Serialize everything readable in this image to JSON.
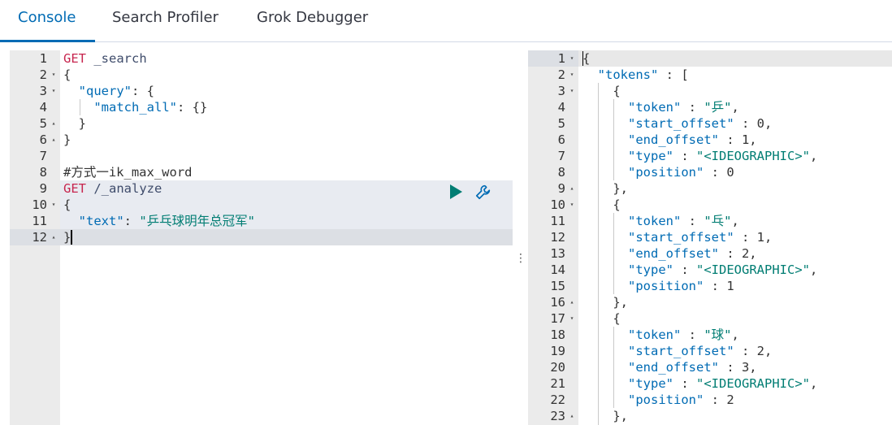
{
  "tabs": [
    {
      "label": "Console"
    },
    {
      "label": "Search Profiler"
    },
    {
      "label": "Grok Debugger"
    }
  ],
  "request": {
    "line_numbers": [
      "1",
      "2",
      "3",
      "4",
      "5",
      "6",
      "7",
      "8",
      "9",
      "10",
      "11",
      "12"
    ],
    "lines": [
      {
        "parts": [
          {
            "t": "GET",
            "c": "k-method"
          },
          {
            "t": " _search",
            "c": "k-path"
          }
        ]
      },
      {
        "parts": [
          {
            "t": "{",
            "c": ""
          }
        ]
      },
      {
        "parts": [
          {
            "t": "  ",
            "c": ""
          },
          {
            "t": "\"query\"",
            "c": "k-key"
          },
          {
            "t": ": {",
            "c": ""
          }
        ]
      },
      {
        "parts": [
          {
            "t": "    ",
            "c": ""
          },
          {
            "t": "\"match_all\"",
            "c": "k-key"
          },
          {
            "t": ": {}",
            "c": ""
          }
        ]
      },
      {
        "parts": [
          {
            "t": "  }",
            "c": ""
          }
        ]
      },
      {
        "parts": [
          {
            "t": "}",
            "c": ""
          }
        ]
      },
      {
        "parts": [
          {
            "t": "",
            "c": ""
          }
        ]
      },
      {
        "parts": [
          {
            "t": "#方式一ik_max_word",
            "c": "k-comment"
          }
        ]
      },
      {
        "parts": [
          {
            "t": "GET",
            "c": "k-method"
          },
          {
            "t": " /_analyze",
            "c": "k-path"
          }
        ]
      },
      {
        "parts": [
          {
            "t": "{",
            "c": ""
          }
        ]
      },
      {
        "parts": [
          {
            "t": "  ",
            "c": ""
          },
          {
            "t": "\"text\"",
            "c": "k-key"
          },
          {
            "t": ": ",
            "c": ""
          },
          {
            "t": "\"乒乓球明年总冠军\"",
            "c": "k-str"
          }
        ]
      },
      {
        "parts": [
          {
            "t": "}",
            "c": ""
          }
        ]
      }
    ],
    "folds": [
      "",
      "▾",
      "▾",
      "",
      "▴",
      "▴",
      "",
      "",
      "",
      "▾",
      "",
      "▴"
    ]
  },
  "response": {
    "line_numbers": [
      "1",
      "2",
      "3",
      "4",
      "5",
      "6",
      "7",
      "8",
      "9",
      "10",
      "11",
      "12",
      "13",
      "14",
      "15",
      "16",
      "17",
      "18",
      "19",
      "20",
      "21",
      "22",
      "23"
    ],
    "folds": [
      "▾",
      "▾",
      "▾",
      "",
      "",
      "",
      "",
      "",
      "▴",
      "▾",
      "",
      "",
      "",
      "",
      "",
      "▴",
      "▾",
      "",
      "",
      "",
      "",
      "",
      "▴"
    ],
    "lines": [
      {
        "parts": [
          {
            "t": "{",
            "c": ""
          }
        ]
      },
      {
        "parts": [
          {
            "t": "  ",
            "c": ""
          },
          {
            "t": "\"tokens\"",
            "c": "k-key"
          },
          {
            "t": " : [",
            "c": ""
          }
        ]
      },
      {
        "parts": [
          {
            "t": "    {",
            "c": ""
          }
        ]
      },
      {
        "parts": [
          {
            "t": "      ",
            "c": ""
          },
          {
            "t": "\"token\"",
            "c": "k-key"
          },
          {
            "t": " : ",
            "c": ""
          },
          {
            "t": "\"乒\"",
            "c": "k-str"
          },
          {
            "t": ",",
            "c": ""
          }
        ]
      },
      {
        "parts": [
          {
            "t": "      ",
            "c": ""
          },
          {
            "t": "\"start_offset\"",
            "c": "k-key"
          },
          {
            "t": " : 0,",
            "c": ""
          }
        ]
      },
      {
        "parts": [
          {
            "t": "      ",
            "c": ""
          },
          {
            "t": "\"end_offset\"",
            "c": "k-key"
          },
          {
            "t": " : 1,",
            "c": ""
          }
        ]
      },
      {
        "parts": [
          {
            "t": "      ",
            "c": ""
          },
          {
            "t": "\"type\"",
            "c": "k-key"
          },
          {
            "t": " : ",
            "c": ""
          },
          {
            "t": "\"<IDEOGRAPHIC>\"",
            "c": "k-str"
          },
          {
            "t": ",",
            "c": ""
          }
        ]
      },
      {
        "parts": [
          {
            "t": "      ",
            "c": ""
          },
          {
            "t": "\"position\"",
            "c": "k-key"
          },
          {
            "t": " : 0",
            "c": ""
          }
        ]
      },
      {
        "parts": [
          {
            "t": "    },",
            "c": ""
          }
        ]
      },
      {
        "parts": [
          {
            "t": "    {",
            "c": ""
          }
        ]
      },
      {
        "parts": [
          {
            "t": "      ",
            "c": ""
          },
          {
            "t": "\"token\"",
            "c": "k-key"
          },
          {
            "t": " : ",
            "c": ""
          },
          {
            "t": "\"乓\"",
            "c": "k-str"
          },
          {
            "t": ",",
            "c": ""
          }
        ]
      },
      {
        "parts": [
          {
            "t": "      ",
            "c": ""
          },
          {
            "t": "\"start_offset\"",
            "c": "k-key"
          },
          {
            "t": " : 1,",
            "c": ""
          }
        ]
      },
      {
        "parts": [
          {
            "t": "      ",
            "c": ""
          },
          {
            "t": "\"end_offset\"",
            "c": "k-key"
          },
          {
            "t": " : 2,",
            "c": ""
          }
        ]
      },
      {
        "parts": [
          {
            "t": "      ",
            "c": ""
          },
          {
            "t": "\"type\"",
            "c": "k-key"
          },
          {
            "t": " : ",
            "c": ""
          },
          {
            "t": "\"<IDEOGRAPHIC>\"",
            "c": "k-str"
          },
          {
            "t": ",",
            "c": ""
          }
        ]
      },
      {
        "parts": [
          {
            "t": "      ",
            "c": ""
          },
          {
            "t": "\"position\"",
            "c": "k-key"
          },
          {
            "t": " : 1",
            "c": ""
          }
        ]
      },
      {
        "parts": [
          {
            "t": "    },",
            "c": ""
          }
        ]
      },
      {
        "parts": [
          {
            "t": "    {",
            "c": ""
          }
        ]
      },
      {
        "parts": [
          {
            "t": "      ",
            "c": ""
          },
          {
            "t": "\"token\"",
            "c": "k-key"
          },
          {
            "t": " : ",
            "c": ""
          },
          {
            "t": "\"球\"",
            "c": "k-str"
          },
          {
            "t": ",",
            "c": ""
          }
        ]
      },
      {
        "parts": [
          {
            "t": "      ",
            "c": ""
          },
          {
            "t": "\"start_offset\"",
            "c": "k-key"
          },
          {
            "t": " : 2,",
            "c": ""
          }
        ]
      },
      {
        "parts": [
          {
            "t": "      ",
            "c": ""
          },
          {
            "t": "\"end_offset\"",
            "c": "k-key"
          },
          {
            "t": " : 3,",
            "c": ""
          }
        ]
      },
      {
        "parts": [
          {
            "t": "      ",
            "c": ""
          },
          {
            "t": "\"type\"",
            "c": "k-key"
          },
          {
            "t": " : ",
            "c": ""
          },
          {
            "t": "\"<IDEOGRAPHIC>\"",
            "c": "k-str"
          },
          {
            "t": ",",
            "c": ""
          }
        ]
      },
      {
        "parts": [
          {
            "t": "      ",
            "c": ""
          },
          {
            "t": "\"position\"",
            "c": "k-key"
          },
          {
            "t": " : 2",
            "c": ""
          }
        ]
      },
      {
        "parts": [
          {
            "t": "    },",
            "c": ""
          }
        ]
      }
    ]
  },
  "colors": {
    "accent": "#006bb4",
    "method": "#c7254e",
    "string": "#017d73",
    "play": "#017d73"
  },
  "icons": {
    "run": "play-icon",
    "settings": "wrench-icon",
    "resize": "vertical-dots-icon"
  }
}
